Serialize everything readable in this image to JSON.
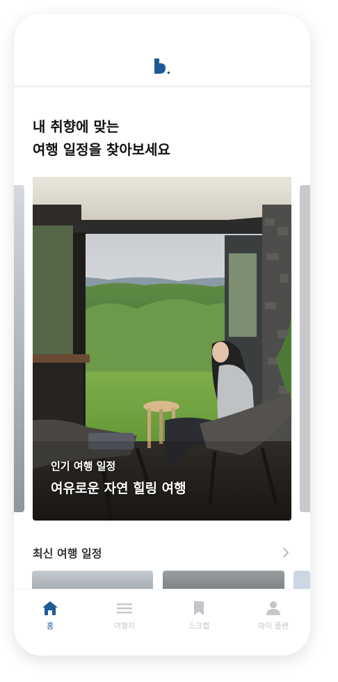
{
  "colors": {
    "brand": "#1f5a97",
    "inactive": "#c3c6ca"
  },
  "header": {
    "logo_icon": "brand-logo-icon"
  },
  "headline": {
    "line1": "내 취향에 맞는",
    "line2": "여행 일정을 찾아보세요"
  },
  "featured": {
    "subtitle": "인기 여행 일정",
    "title": "여유로운 자연 힐링 여행"
  },
  "recent": {
    "title": "최신 여행 일정",
    "more_icon": "chevron-right-icon"
  },
  "tabs": [
    {
      "label": "홈",
      "icon": "home-icon",
      "active": true
    },
    {
      "label": "여행지",
      "icon": "list-icon",
      "active": false
    },
    {
      "label": "스크랩",
      "icon": "bookmark-icon",
      "active": false
    },
    {
      "label": "마이 플랜",
      "icon": "person-icon",
      "active": false
    }
  ]
}
